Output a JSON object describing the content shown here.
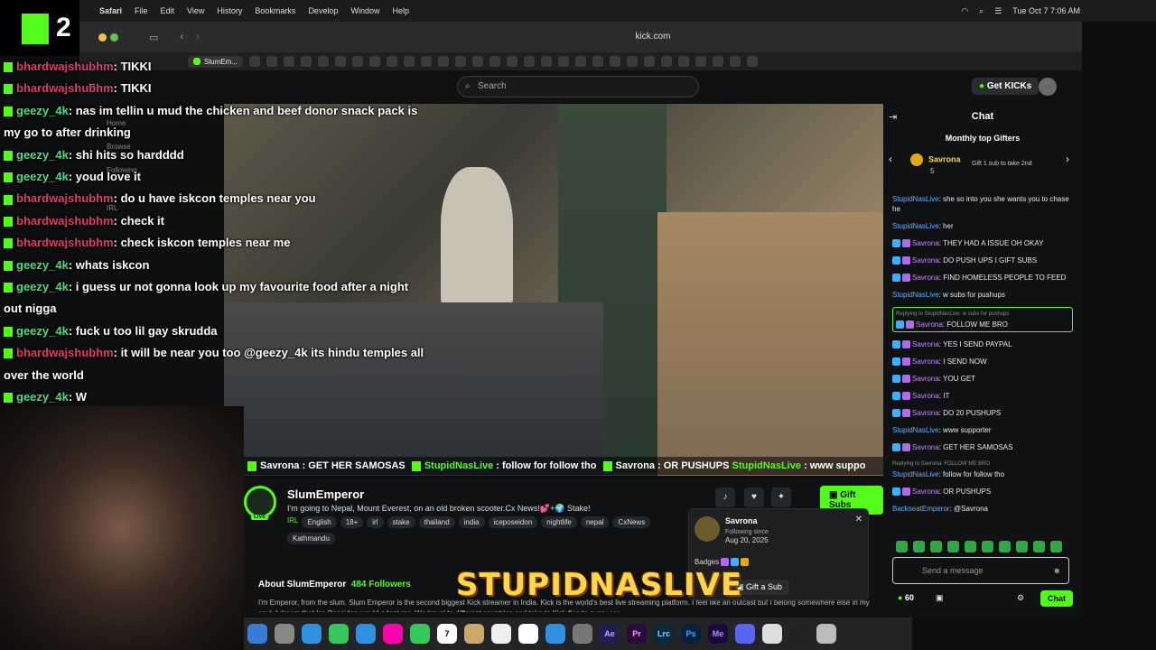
{
  "menubar": {
    "app": "Safari",
    "items": [
      "File",
      "Edit",
      "View",
      "History",
      "Bookmarks",
      "Develop",
      "Window",
      "Help"
    ],
    "datetime": "Tue Oct 7  7:06 AM"
  },
  "browser": {
    "url": "kick.com",
    "active_tab": "SlumEm..."
  },
  "kick": {
    "search_placeholder": "Search",
    "get_kicks": "Get KICKs",
    "sidebar": [
      "Home",
      "Browse",
      "Following",
      "IRL"
    ],
    "chat_title": "Chat",
    "monthly_top_gifters": "Monthly top Gifters",
    "top_gifter": {
      "name": "Savrona",
      "count": "5",
      "cta": "Gift 1 sub to take 2nd"
    },
    "chat_messages": [
      {
        "user": "StupidNasLive",
        "text": "she so into you she wants you to chase he",
        "style": "u1"
      },
      {
        "user": "StupidNasLive",
        "text": "her",
        "style": "u1"
      },
      {
        "user": "Savrona",
        "text": "THEY HAD A ISSUE OH OKAY",
        "style": "u2"
      },
      {
        "user": "Savrona",
        "text": "DO PUSH UPS I GIFT SUBS",
        "style": "u2"
      },
      {
        "user": "Savrona",
        "text": "FIND HOMELESS PEOPLE TO FEED",
        "style": "u2"
      },
      {
        "user": "StupidNasLive",
        "text": "w subs for pushups",
        "style": "u1"
      },
      {
        "user": "Savrona",
        "text": "FOLLOW ME BRO",
        "style": "u2",
        "reply": "Replying to StupidNasLive: w subs for pushups",
        "highlight": true
      },
      {
        "user": "Savrona",
        "text": "YES I SEND PAYPAL",
        "style": "u2"
      },
      {
        "user": "Savrona",
        "text": "I SEND NOW",
        "style": "u2"
      },
      {
        "user": "Savrona",
        "text": "YOU GET",
        "style": "u2"
      },
      {
        "user": "Savrona",
        "text": "IT",
        "style": "u2"
      },
      {
        "user": "Savrona",
        "text": "DO 20 PUSHUPS",
        "style": "u2"
      },
      {
        "user": "StupidNasLive",
        "text": "www supporter",
        "style": "u1"
      },
      {
        "user": "Savrona",
        "text": "GET HER SAMOSAS",
        "style": "u2"
      },
      {
        "user": "StupidNasLive",
        "text": "follow for follow tho",
        "style": "u1",
        "reply": "Replying to Savrona: FOLLOW ME BRO"
      },
      {
        "user": "Savrona",
        "text": "OR PUSHUPS",
        "style": "u2"
      },
      {
        "user": "BackseatEmperor",
        "text": "@Savrona",
        "style": "u3"
      }
    ],
    "chat_input_placeholder": "Send a message",
    "kicks_balance": "60",
    "chat_button": "Chat"
  },
  "overlay_chat": [
    {
      "user": "bhardwajshubhm",
      "text": ": TIKKI",
      "color": "n1"
    },
    {
      "user": "bhardwajshubhm",
      "text": ": TIKKI",
      "color": "n1"
    },
    {
      "user": "geezy_4k",
      "text": ": nas im tellin u mud the chicken and beef donor snack pack is",
      "color": "n2"
    },
    {
      "user": "",
      "text": "my go to after drinking",
      "color": "n2"
    },
    {
      "user": "geezy_4k",
      "text": ": shi hits so hardddd",
      "color": "n2"
    },
    {
      "user": "geezy_4k",
      "text": ": youd love it",
      "color": "n2"
    },
    {
      "user": "bhardwajshubhm",
      "text": ": do u have iskcon temples near you",
      "color": "n1"
    },
    {
      "user": "bhardwajshubhm",
      "text": ": check it",
      "color": "n1"
    },
    {
      "user": "bhardwajshubhm",
      "text": ": check iskcon temples near me",
      "color": "n1"
    },
    {
      "user": "geezy_4k",
      "text": ": whats iskcon",
      "color": "n2"
    },
    {
      "user": "geezy_4k",
      "text": ": i guess ur not gonna look up my favourite food after a night",
      "color": "n2"
    },
    {
      "user": "",
      "text": "out nigga",
      "color": "n2"
    },
    {
      "user": "geezy_4k",
      "text": ": fuck u too lil gay skrudda",
      "color": "n2"
    },
    {
      "user": "bhardwajshubhm",
      "text": ": it will be near you too @geezy_4k its hindu temples all",
      "color": "n1"
    },
    {
      "user": "",
      "text": "over the world",
      "color": "n1"
    },
    {
      "user": "geezy_4k",
      "text": ": W",
      "color": "n2"
    }
  ],
  "ticker": [
    {
      "user": "Savrona",
      "text": " : GET HER SAMOSAS "
    },
    {
      "user": "StupidNasLive",
      "text": " : follow for follow tho "
    },
    {
      "user": "Savrona",
      "text": " : OR PUSHUPS "
    },
    {
      "user": "StupidNasLive",
      "text": " : www suppo"
    }
  ],
  "stream": {
    "streamer": "SlumEmperor",
    "live_badge": "LIVE",
    "title": "I'm going to Nepal, Mount Everest, on an old broken scooter.Cx News!💕+🌍 Stake!",
    "category": "IRL",
    "tags": [
      "English",
      "18+",
      "irl",
      "stake",
      "thailand",
      "india",
      "iceposeidon",
      "nightlife",
      "nepal",
      "CxNews"
    ],
    "tag_extra": "Kathmandu",
    "gift_subs": "Gift Subs",
    "about_label": "About SlumEmperor",
    "followers": "484 Followers",
    "about_text": "I'm Emperor, from the slum. Slum Emperor is the second biggest Kick streamer in India. Kick is the world's best live streaming platform. I feel like an outcast but I belong somewhere else in my soul. I dream that Ice Poseidon would adopt me. We travel to different countries and take to Kick flag to every cor"
  },
  "usercard": {
    "name": "Savrona",
    "following_since": "Following since",
    "date": "Aug 20, 2025",
    "badges_label": "Badges",
    "gift_a_sub": "Gift a Sub"
  },
  "watermark": "STUPIDNASLIVE",
  "corner_logo": "2",
  "dock_apps": [
    "Finder",
    "Launchpad",
    "Safari",
    "Messages",
    "Mail",
    "Photos",
    "FaceTime",
    "Calendar",
    "Notes",
    "Reminders",
    "Freeform",
    "App Store",
    "Settings",
    "Ae",
    "Pr",
    "Lrc",
    "Ps",
    "Me",
    "Discord",
    "Chrome",
    "Terminal",
    "Trash"
  ]
}
